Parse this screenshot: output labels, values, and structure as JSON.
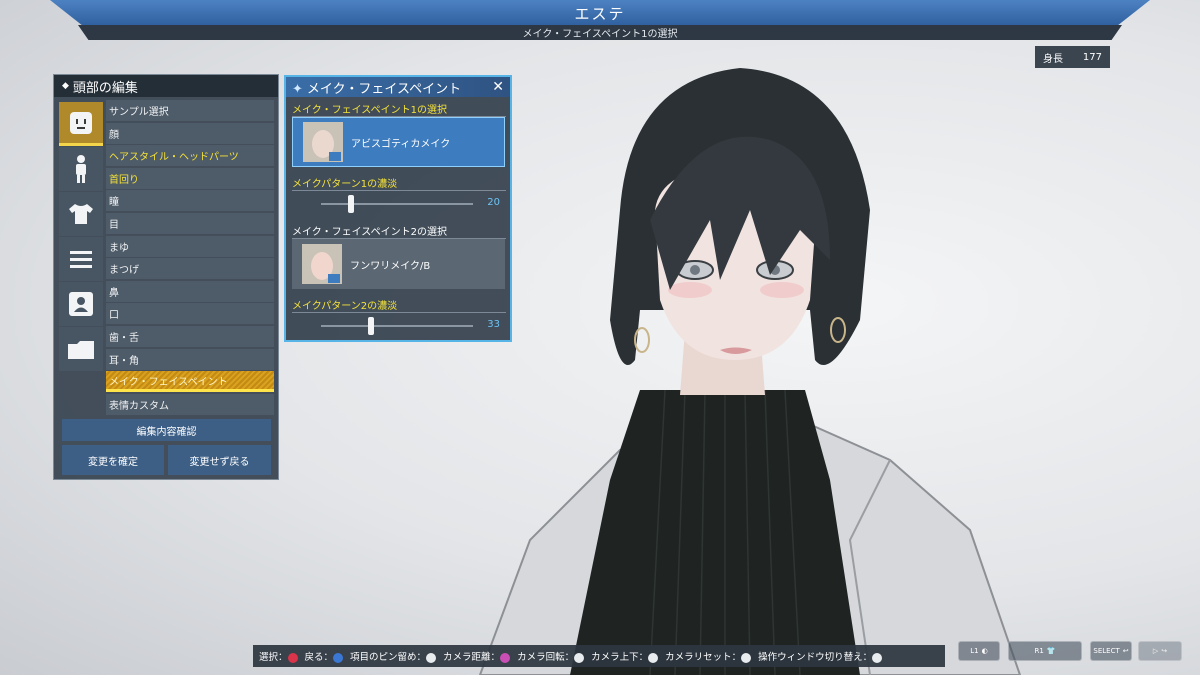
{
  "header": {
    "title": "エステ",
    "subtitle": "メイク・フェイスペイント1の選択"
  },
  "stats": {
    "height_label": "身長",
    "height_value": "177"
  },
  "left_panel": {
    "title": "頭部の編集",
    "items": [
      {
        "label": "サンプル選択",
        "style": "normal"
      },
      {
        "label": "顔",
        "style": "normal"
      },
      {
        "label": "ヘアスタイル・ヘッドパーツ",
        "style": "yellow"
      },
      {
        "label": "首回り",
        "style": "yellow"
      },
      {
        "label": "瞳",
        "style": "normal"
      },
      {
        "label": "目",
        "style": "normal"
      },
      {
        "label": "まゆ",
        "style": "normal"
      },
      {
        "label": "まつげ",
        "style": "normal"
      },
      {
        "label": "鼻",
        "style": "normal"
      },
      {
        "label": "口",
        "style": "normal"
      },
      {
        "label": "歯・舌",
        "style": "normal"
      },
      {
        "label": "耳・角",
        "style": "normal"
      },
      {
        "label": "メイク・フェイスペイント",
        "style": "selected"
      },
      {
        "label": "表情カスタム",
        "style": "normal"
      }
    ],
    "confirm_button": "編集内容確認",
    "apply_button": "変更を確定",
    "cancel_button": "変更せず戻る"
  },
  "makeup_panel": {
    "title": "メイク・フェイスペイント",
    "sections": [
      {
        "label": "メイク・フェイスペイント1の選択",
        "item": "アビスゴティカメイク"
      },
      {
        "label": "メイクパターン1の濃淡",
        "value": "20",
        "fraction": 0.2
      },
      {
        "label": "メイク・フェイスペイント2の選択",
        "item": "フンワリメイク/B"
      },
      {
        "label": "メイクパターン2の濃淡",
        "value": "33",
        "fraction": 0.33
      }
    ]
  },
  "help_bar": [
    {
      "label": "選択：",
      "glyph_color": "#d9344a"
    },
    {
      "label": "戻る：",
      "glyph_color": "#3b78d4"
    },
    {
      "label": "項目のピン留め：",
      "glyph_color": "#e9ecef"
    },
    {
      "label": "カメラ距離：",
      "glyph_color": "#c94fb5"
    },
    {
      "label": "カメラ回転：",
      "glyph_color": "#e9ecef"
    },
    {
      "label": "カメラ上下：",
      "glyph_color": "#e9ecef"
    },
    {
      "label": "カメラリセット：",
      "glyph_color": "#e9ecef"
    },
    {
      "label": "操作ウィンドウ切り替え：",
      "glyph_color": "#e9ecef"
    }
  ],
  "corner_buttons": [
    "L1",
    "R1",
    "SELECT",
    ""
  ],
  "colors": {
    "accent_blue": "#3d7cbf",
    "selected_gold": "#d9a21f",
    "highlight_yellow": "#f4e23a"
  }
}
